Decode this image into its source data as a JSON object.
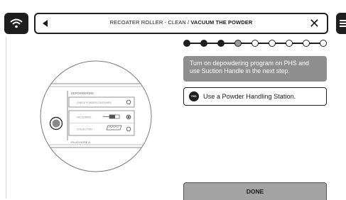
{
  "header": {
    "title_prefix": "RECOATER ROLLER - CLEAN / ",
    "title_bold": "VACUUM THE POWDER",
    "close_label": "✕"
  },
  "progress": {
    "total_steps": 9,
    "completed_steps": 3,
    "current_step": 4
  },
  "instruction": {
    "info_text": "Turn on depowdering program on PHS and use Suction Handle in the next step.",
    "phs_badge": "PHS",
    "phs_text": "Use a Powder Handling Station."
  },
  "illustration": {
    "section_title": "DEPOWDERING",
    "row1_label": "CHECK POWDER CONTAINER",
    "row2_label": "VACUUMING",
    "row3_label": "COLLECTION",
    "footer_label": "PLUG HOSE A"
  },
  "actions": {
    "done_label": "DONE"
  },
  "colors": {
    "dark": "#1e1e1e",
    "info_bg": "#8e8e8e",
    "done_bg": "#a3a3a3"
  }
}
